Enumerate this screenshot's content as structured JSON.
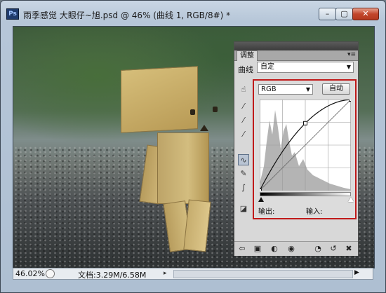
{
  "window": {
    "title": "雨季感觉  大眼仔~旭.psd @ 46% (曲线 1, RGB/8#) *",
    "app_icon_text": "Ps",
    "controls": {
      "minimize": "–",
      "maximize": "▢",
      "close": "✕"
    }
  },
  "status": {
    "zoom": "46.02%",
    "doc_info": "文档:3.29M/6.58M",
    "arrow": "▸"
  },
  "panel": {
    "tab_label": "调整",
    "menu_glyph": "▾≡",
    "curves_label": "曲线",
    "preset_value": "自定",
    "channel_value": "RGB",
    "auto_button": "自动",
    "output_label": "输出:",
    "input_label": "输入:"
  },
  "curve": {
    "points": [
      [
        0,
        0
      ],
      [
        50,
        74
      ],
      [
        100,
        100
      ]
    ],
    "colors": {
      "highlight_frame": "#c01a1a",
      "histogram": "#b4b4b4"
    }
  },
  "icons": {
    "adjust_tool": "finger-adjust-icon",
    "eyedropper_black": "eyedropper-black-icon",
    "eyedropper_gray": "eyedropper-gray-icon",
    "eyedropper_white": "eyedropper-white-icon",
    "curve_point": "curve-point-icon",
    "pencil": "pencil-icon",
    "smooth": "smooth-icon",
    "clip": "clip-warning-icon"
  }
}
